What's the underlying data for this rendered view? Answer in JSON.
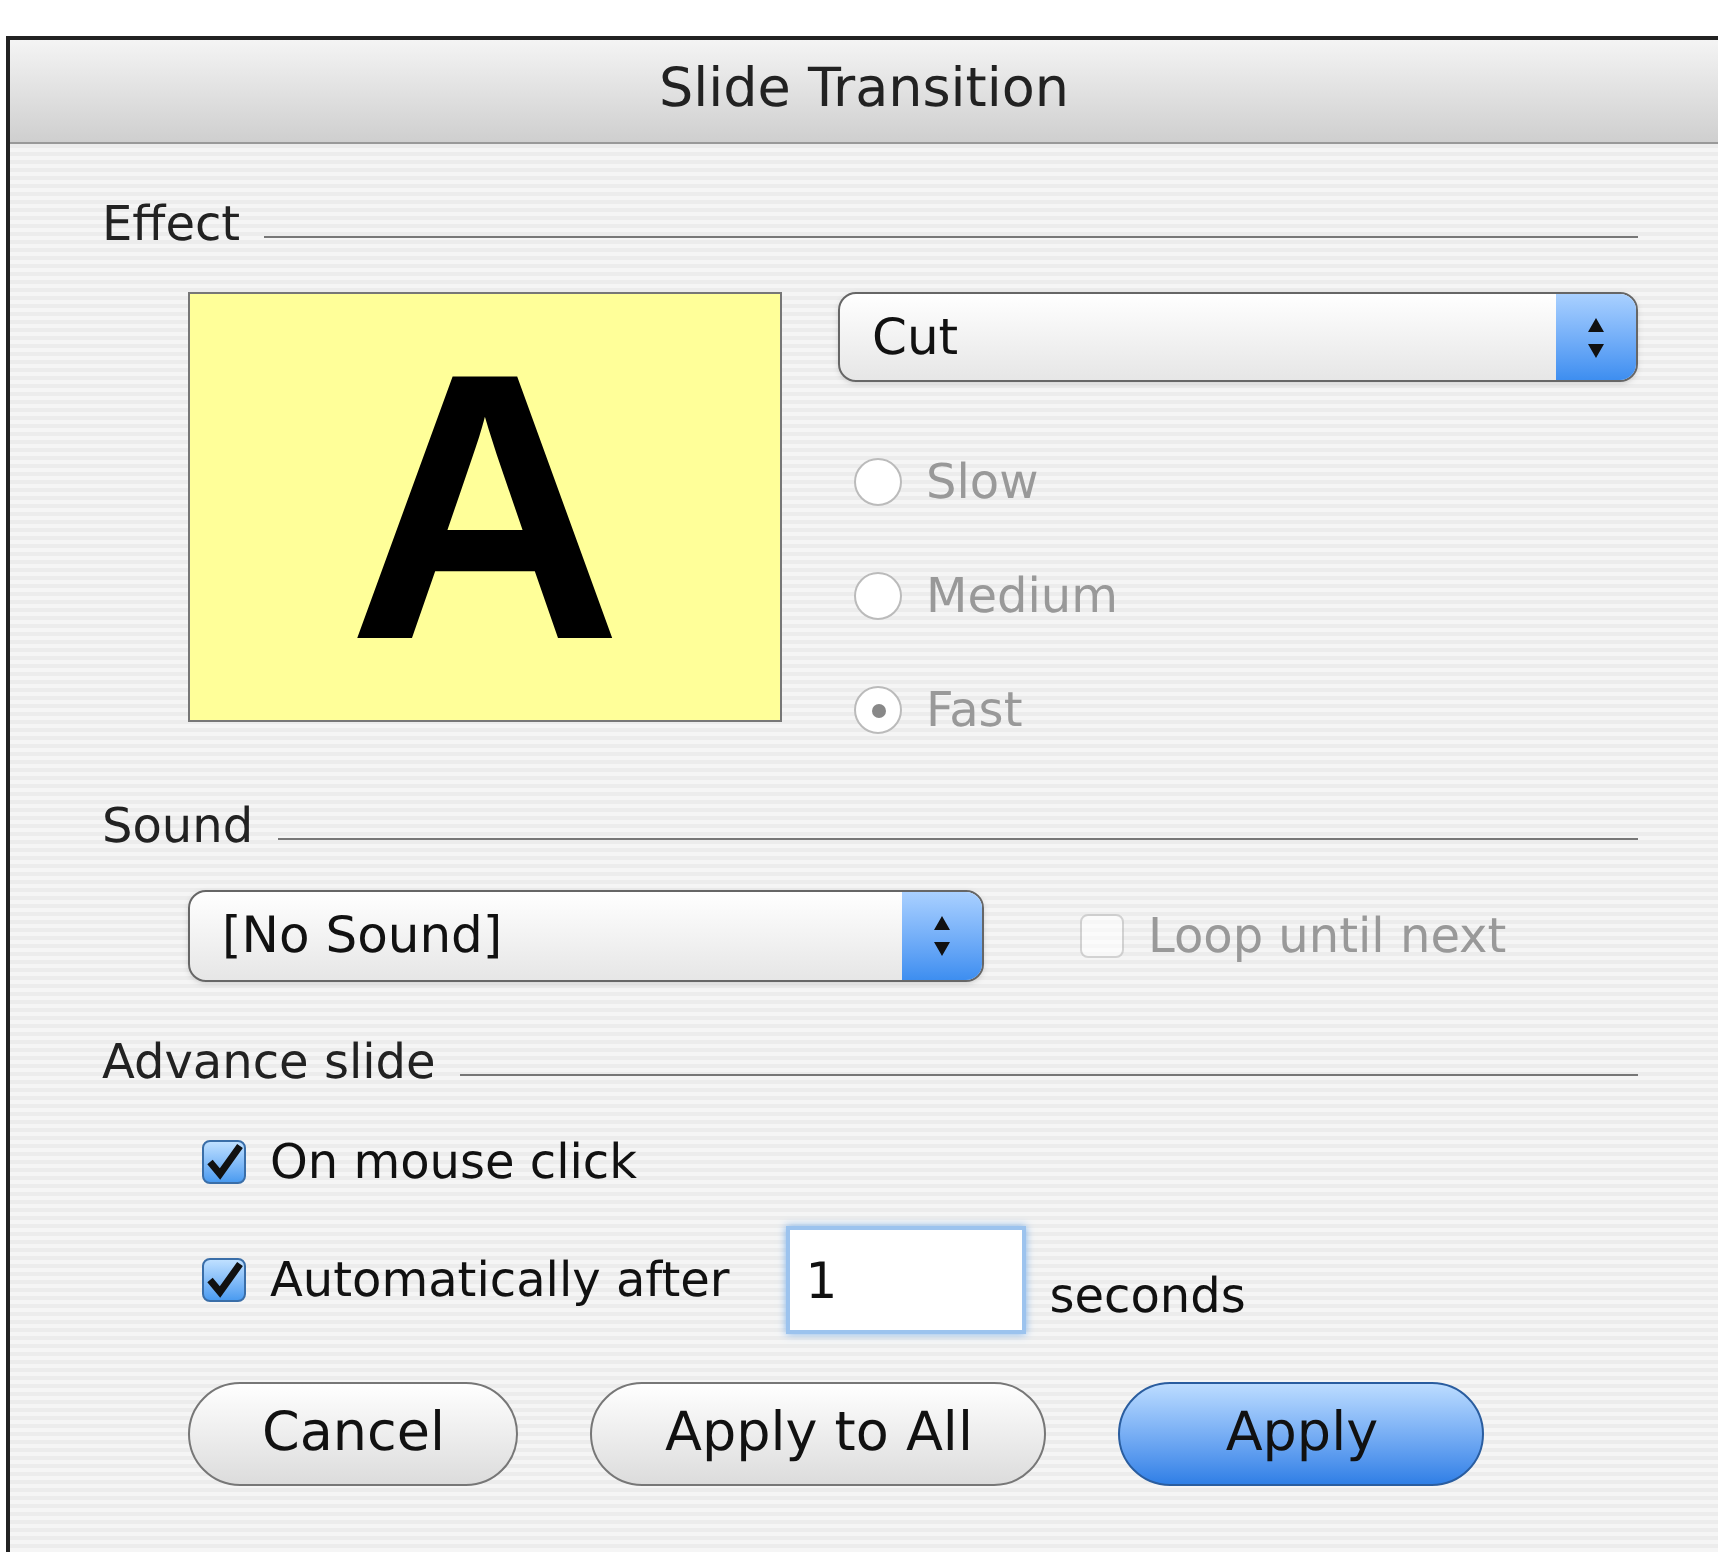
{
  "window": {
    "title": "Slide Transition"
  },
  "effect": {
    "label": "Effect",
    "preview": {
      "letter": "A"
    },
    "popup": {
      "value": "Cut"
    },
    "speeds": [
      {
        "label": "Slow",
        "selected": false,
        "disabled": true
      },
      {
        "label": "Medium",
        "selected": false,
        "disabled": true
      },
      {
        "label": "Fast",
        "selected": true,
        "disabled": true
      }
    ]
  },
  "sound": {
    "label": "Sound",
    "popup": {
      "value": "[No Sound]"
    },
    "loop": {
      "label": "Loop until next",
      "checked": false,
      "disabled": true
    }
  },
  "advance": {
    "label": "Advance slide",
    "options": [
      {
        "kind": "checkbox",
        "label": "On mouse click",
        "checked": true
      },
      {
        "kind": "timed",
        "label": "Automatically after",
        "checked": true,
        "value": "1",
        "unit": "seconds"
      }
    ]
  },
  "buttons": [
    {
      "label": "Cancel",
      "default": false
    },
    {
      "label": "Apply to All",
      "default": false
    },
    {
      "label": "Apply",
      "default": true
    }
  ]
}
